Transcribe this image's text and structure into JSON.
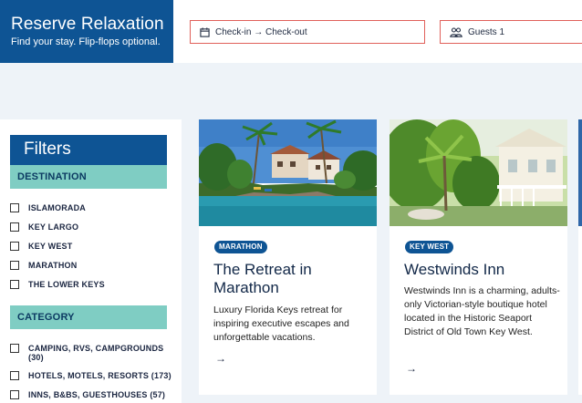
{
  "brand": {
    "title": "Reserve Relaxation",
    "subtitle": "Find your stay. Flip-flops optional."
  },
  "search": {
    "dates_label": "Check-in → Check-out",
    "guests_label": "Guests 1"
  },
  "filters": {
    "title": "Filters",
    "destination_heading": "DESTINATION",
    "destinations": [
      "ISLAMORADA",
      "KEY LARGO",
      "KEY WEST",
      "MARATHON",
      "THE LOWER KEYS"
    ],
    "category_heading": "CATEGORY",
    "categories": [
      "CAMPING, RVS, CAMPGROUNDS (30)",
      "HOTELS, MOTELS, RESORTS (173)",
      "INNS, B&BS, GUESTHOUSES (57)"
    ]
  },
  "cards": [
    {
      "badge": "MARATHON",
      "title": "The Retreat in Marathon",
      "description": "Luxury Florida Keys retreat for inspiring executive escapes and unforgettable vacations.",
      "arrow": "→"
    },
    {
      "badge": "KEY WEST",
      "title": "Westwinds Inn",
      "description": "Westwinds Inn is a charming, adults-only Victorian-style boutique hotel located in the Historic Seaport District of Old Town Key West.",
      "arrow": "→"
    }
  ],
  "icons": {
    "dates": "calendar-icon",
    "guests": "people-icon",
    "more": "arrow-right-icon"
  },
  "colors": {
    "brand": "#0e5494",
    "accent": "#7fcdc3",
    "field_border": "#e0605a",
    "background": "#eef3f8"
  }
}
